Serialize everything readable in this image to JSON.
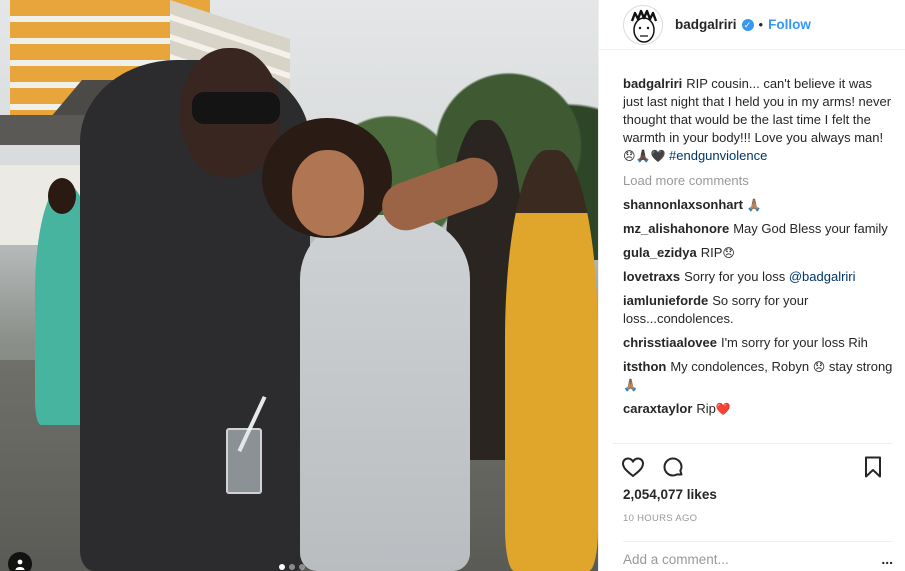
{
  "post": {
    "username": "badgalriri",
    "verified_icon": "verified-badge-icon",
    "separator": "•",
    "follow_label": "Follow",
    "caption": {
      "username": "badgalriri",
      "text": "RIP cousin... can't believe it was just last night that I held you in my arms! never thought that would be the last time I felt the warmth in your body!!! Love you always man! ",
      "emoji": "😞🙏🏿🖤",
      "hashtag": "#endgunviolence"
    },
    "load_more": "Load more comments",
    "comments": [
      {
        "user": "shannonlaxsonhart",
        "text": "",
        "emoji": "🙏🏽"
      },
      {
        "user": "mz_alishahonore",
        "text": "May God Bless your family",
        "emoji": ""
      },
      {
        "user": "gula_ezidya",
        "text": "RIP",
        "emoji": "😞"
      },
      {
        "user": "lovetraxs",
        "text": "Sorry for you loss ",
        "mention": "@badgalriri",
        "emoji": ""
      },
      {
        "user": "iamlunieforde",
        "text": "So sorry for your loss...condolences.",
        "emoji": ""
      },
      {
        "user": "chrisstiaalovee",
        "text": "I'm sorry for your loss Rih",
        "emoji": ""
      },
      {
        "user": "itsthon",
        "text": "My condolences, Robyn ",
        "emoji": "😞",
        "text2": " stay strong ",
        "emoji2": "🙏🏽"
      },
      {
        "user": "caraxtaylor",
        "text": "Rip",
        "emoji": "❤️"
      }
    ],
    "likes": "2,054,077 likes",
    "time": "10 HOURS AGO",
    "add_comment_placeholder": "Add a comment...",
    "more_label": "...",
    "icons": {
      "like": "heart-icon",
      "comment": "comment-icon",
      "save": "bookmark-icon",
      "tag": "user-tag-icon"
    },
    "carousel": {
      "count": 3,
      "active": 1
    }
  },
  "colors": {
    "link": "#3897f0",
    "hashtag": "#003569",
    "muted": "#999999",
    "text": "#262626"
  }
}
